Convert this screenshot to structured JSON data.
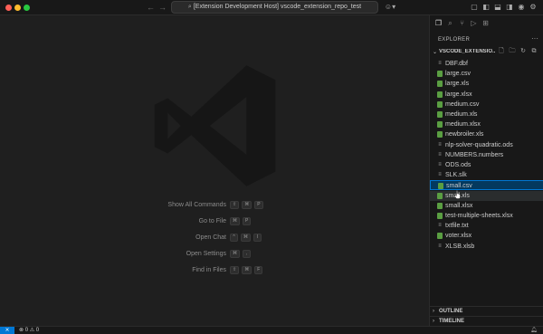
{
  "titlebar": {
    "command_center": "[Extension Development Host] vscode_extension_repo_test",
    "back_icon": "arrow-left-icon",
    "forward_icon": "arrow-right-icon",
    "layout_icons": [
      "copilot-icon",
      "toggle-panel-left-icon",
      "toggle-panel-icon",
      "toggle-sidebar-icon",
      "customize-layout-icon",
      "account-icon",
      "gear-icon"
    ]
  },
  "editor": {
    "shortcuts": [
      {
        "label": "Show All Commands",
        "keys": [
          "⇧",
          "⌘",
          "P"
        ]
      },
      {
        "label": "Go to File",
        "keys": [
          "⌘",
          "P"
        ]
      },
      {
        "label": "Open Chat",
        "keys": [
          "^",
          "⌘",
          "I"
        ]
      },
      {
        "label": "Open Settings",
        "keys": [
          "⌘",
          ","
        ]
      },
      {
        "label": "Find in Files",
        "keys": [
          "⇧",
          "⌘",
          "F"
        ]
      }
    ]
  },
  "sidebar": {
    "title": "EXPLORER",
    "folder": "VSCODE_EXTENSIO...",
    "files": [
      {
        "name": "DBF.dbf",
        "type": "text"
      },
      {
        "name": "large.csv",
        "type": "sheet"
      },
      {
        "name": "large.xls",
        "type": "sheet"
      },
      {
        "name": "large.xlsx",
        "type": "sheet"
      },
      {
        "name": "medium.csv",
        "type": "sheet"
      },
      {
        "name": "medium.xls",
        "type": "sheet"
      },
      {
        "name": "medium.xlsx",
        "type": "sheet"
      },
      {
        "name": "newbroiler.xls",
        "type": "sheet"
      },
      {
        "name": "nlp-solver-quadratic.ods",
        "type": "text"
      },
      {
        "name": "NUMBERS.numbers",
        "type": "text"
      },
      {
        "name": "ODS.ods",
        "type": "text"
      },
      {
        "name": "SLK.slk",
        "type": "text"
      },
      {
        "name": "small.csv",
        "type": "sheet",
        "state": "selected"
      },
      {
        "name": "small.xls",
        "type": "sheet",
        "state": "hover"
      },
      {
        "name": "small.xlsx",
        "type": "sheet"
      },
      {
        "name": "test-multiple-sheets.xlsx",
        "type": "sheet"
      },
      {
        "name": "txtfile.txt",
        "type": "text"
      },
      {
        "name": "voter.xlsx",
        "type": "sheet"
      },
      {
        "name": "XLSB.xlsb",
        "type": "text"
      }
    ],
    "sections": [
      "OUTLINE",
      "TIMELINE"
    ]
  },
  "statusbar": {
    "errors": "0",
    "warnings": "0"
  },
  "colors": {
    "accent": "#0078d4",
    "sheet_icon": "#5a9e42",
    "editor_bg": "#1f1f1f",
    "sidebar_bg": "#181818"
  }
}
